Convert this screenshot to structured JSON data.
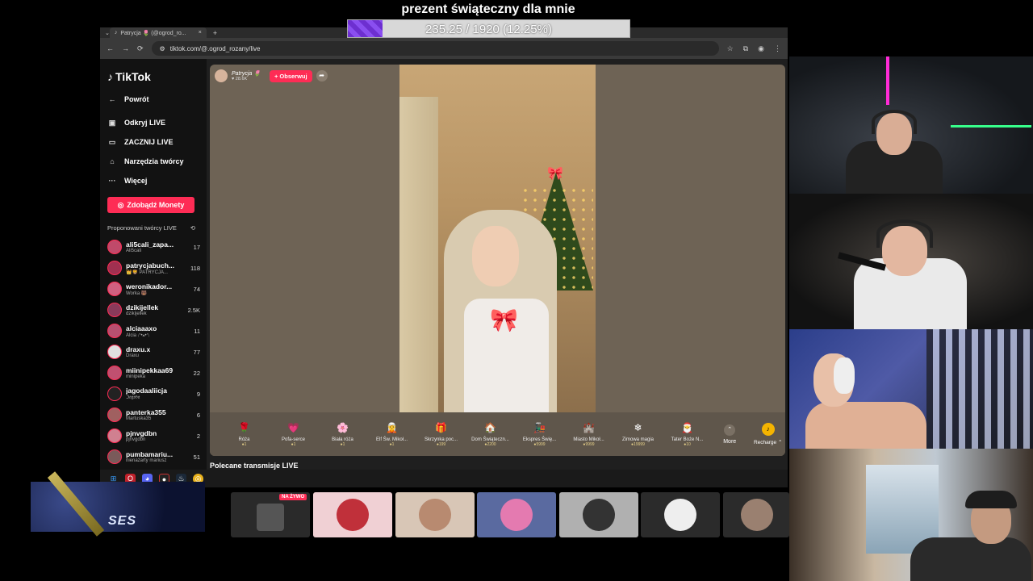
{
  "goal": {
    "title": "prezent świąteczny dla mnie",
    "progress_text": "235.25 / 1920 (12.25%)",
    "progress": 0.1225
  },
  "browser": {
    "tab_title": "Patrycja 🌷 (@ogrod_ro...",
    "tab_close": "×",
    "new_tab": "+",
    "url": "tiktok.com/@.ogrod_rozany/live"
  },
  "sidebar": {
    "logo": "TikTok",
    "nav": [
      {
        "icon": "←",
        "label": "Powrót"
      },
      {
        "icon": "▣",
        "label": "Odkryj LIVE"
      },
      {
        "icon": "▭",
        "label": "ZACZNIJ LIVE"
      },
      {
        "icon": "⌂",
        "label": "Narzędzia twórcy"
      },
      {
        "icon": "···",
        "label": "Więcej"
      }
    ],
    "coins_button": "Zdobądź Monety",
    "suggested_header": "Proponowani twórcy LIVE",
    "creators": [
      {
        "name": "ali5cali_zapa...",
        "sub": "Ali5cali",
        "count": "17"
      },
      {
        "name": "patrycjabuch...",
        "sub": "👑🦁 PATRYCJA...",
        "count": "118"
      },
      {
        "name": "weronikador...",
        "sub": "Worka 🐻",
        "count": "74"
      },
      {
        "name": "dzikijellek",
        "sub": "dzikijellek",
        "count": "2.5K"
      },
      {
        "name": "alciaaaxo",
        "sub": "Alcia ₍ᐢ•ﻌ•ᐢ₎",
        "count": "11"
      },
      {
        "name": "draxu.x",
        "sub": "Draxu",
        "count": "77"
      },
      {
        "name": "miinipekkaa69",
        "sub": "minipeka",
        "count": "22"
      },
      {
        "name": "jagodaaliicja",
        "sub": "ℑ𝔞𝔤𝔬𝔡𝔞",
        "count": "9"
      },
      {
        "name": "panterka355",
        "sub": "Martuska35",
        "count": "6"
      },
      {
        "name": "pjnvgdbn",
        "sub": "pjnvgdbn",
        "count": "2"
      },
      {
        "name": "pumbamariu...",
        "sub": "nienażarty mariusz",
        "count": "51"
      }
    ]
  },
  "live": {
    "host_name": "Patrycja 🌷",
    "host_likes": "♥ 28.6K",
    "follow": "+ Obserwuj",
    "gifts": [
      {
        "icon": "🌹",
        "name": "Róża",
        "price": "●1"
      },
      {
        "icon": "💗",
        "name": "Pofa-serce",
        "price": "●1"
      },
      {
        "icon": "🌸",
        "name": "Biała róża",
        "price": "●1"
      },
      {
        "icon": "🧝",
        "name": "Elf Św. Mikoł...",
        "price": "●1"
      },
      {
        "icon": "🎁",
        "name": "Skrzynka poc...",
        "price": "●199"
      },
      {
        "icon": "🏠",
        "name": "Dom Świąteczn...",
        "price": "●2200"
      },
      {
        "icon": "🚂",
        "name": "Ekspres Świę...",
        "price": "●5999"
      },
      {
        "icon": "🏰",
        "name": "Miasto Mikoł...",
        "price": "●9999"
      },
      {
        "icon": "❄",
        "name": "Zimowa magia",
        "price": "●19999"
      },
      {
        "icon": "🎅",
        "name": "Tater Boże N...",
        "price": "●10"
      }
    ],
    "more": "More",
    "recharge": "Recharge ⌃"
  },
  "recommended": "Polecane transmisje LIVE",
  "thumbs": {
    "live_badge": "NA ŻYWO"
  },
  "ad": {
    "text": "SES"
  }
}
